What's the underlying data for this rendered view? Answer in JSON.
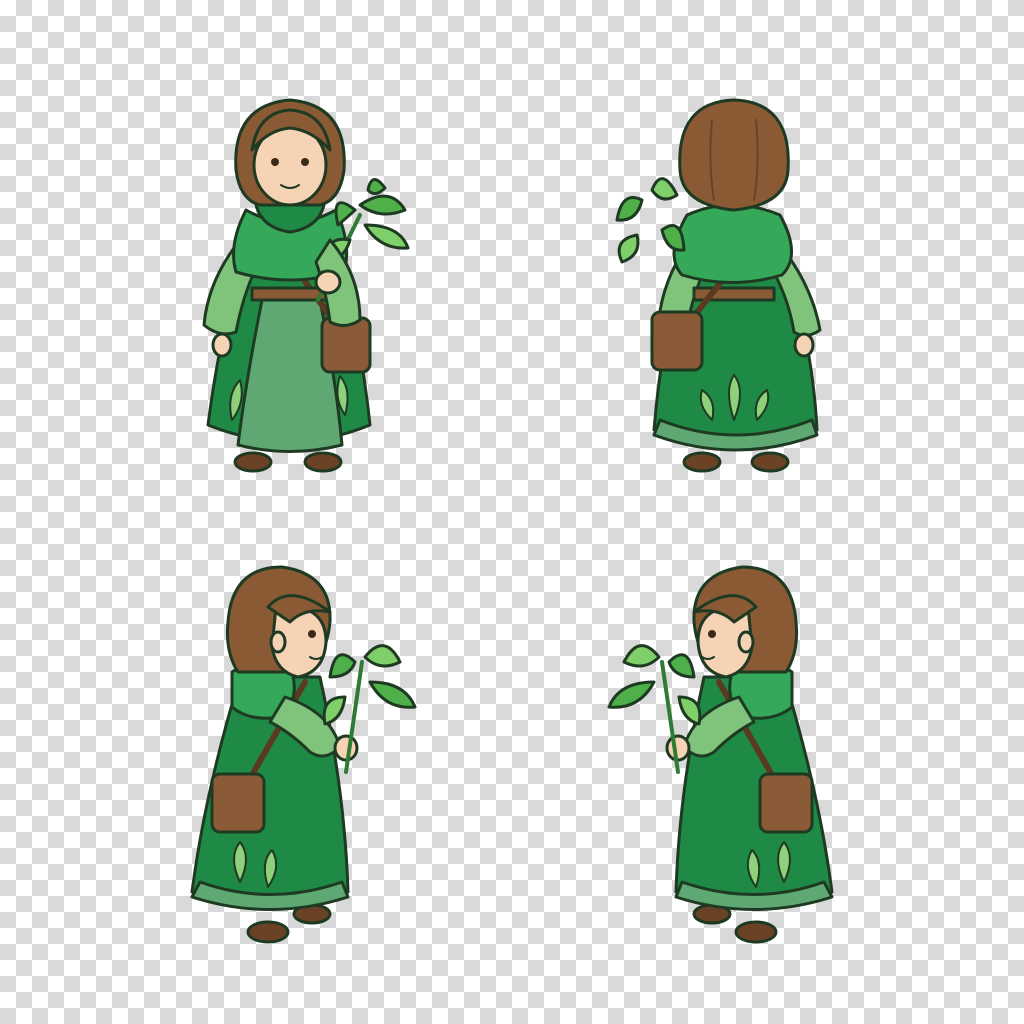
{
  "sprite_sheet": {
    "character": "herbalist",
    "views": [
      {
        "id": "front",
        "facing": "front"
      },
      {
        "id": "back",
        "facing": "back"
      },
      {
        "id": "side-right",
        "facing": "right"
      },
      {
        "id": "side-left",
        "facing": "left"
      }
    ],
    "palette": {
      "robe_dark": "#1f8a45",
      "robe_mid": "#35a85a",
      "robe_light": "#7fc47a",
      "robe_skirt": "#5fa873",
      "leaf_pattern": "#8fd07a",
      "hair": "#8a5a34",
      "hair_shadow": "#6b4226",
      "skin": "#f6d3b5",
      "leather": "#8b5a36",
      "leather_dark": "#5c3a22",
      "outline": "#1e3a22",
      "herb": "#4fb04a",
      "herb_light": "#7fd06a"
    }
  }
}
